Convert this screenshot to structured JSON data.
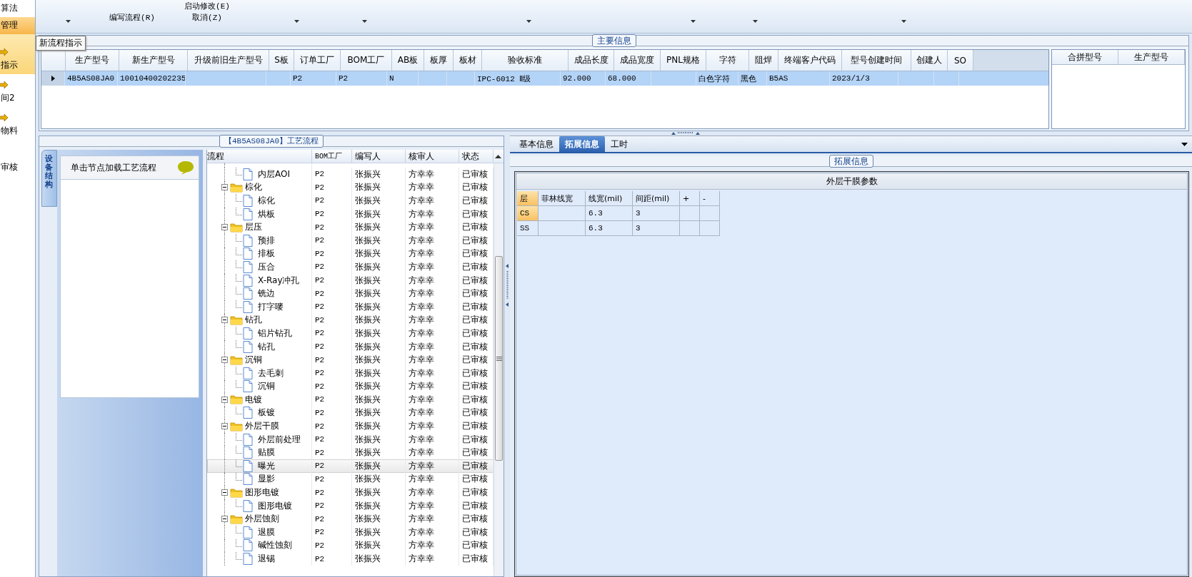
{
  "sidebar": {
    "items": [
      {
        "label": "算法",
        "selected": false,
        "icon": false
      },
      {
        "label": "管理",
        "selected": true,
        "icon": false
      },
      {
        "label": "指示",
        "selected": false,
        "icon": true
      },
      {
        "label": "间2",
        "selected": false,
        "icon": true
      },
      {
        "label": "物料",
        "selected": false,
        "icon": true
      },
      {
        "label": "审核",
        "selected": false,
        "icon": false
      }
    ],
    "tooltip": "新流程指示"
  },
  "toolbar": [
    {
      "menu": true
    },
    {
      "lines": [
        "编写流程(R)"
      ],
      "menu": false
    },
    {
      "lines": [
        "启动修改(E)",
        "取消(Z)"
      ],
      "menu": false
    },
    {
      "menu": true
    },
    {
      "menu": true
    },
    {
      "menu": true
    },
    {
      "menu": true
    },
    {
      "menu": true
    },
    {
      "menu": true
    }
  ],
  "main_info": {
    "title": "主要信息",
    "columns": [
      "生产型号",
      "新生产型号",
      "升级前旧生产型号",
      "S板",
      "订单工厂",
      "BOM工厂",
      "AB板",
      "板厚",
      "板材",
      "验收标准",
      "成品长度",
      "成品宽度",
      "PNL规格",
      "字符",
      "阻焊",
      "终端客户代码",
      "型号创建时间",
      "创建人",
      "SO"
    ],
    "rows": [
      {
        "selected": true,
        "cells": [
          "4B5AS08JA0",
          "10010400202235",
          "",
          "",
          "P2",
          "P2",
          "N",
          "",
          "",
          "IPC-6012 Ⅱ级",
          "92.000",
          "68.000",
          "",
          "白色字符",
          "黑色",
          "B5AS",
          "2023/1/3",
          "",
          ""
        ]
      }
    ],
    "merge_columns": [
      "合拼型号",
      "生产型号"
    ]
  },
  "process": {
    "title": "【4B5AS08JA0】工艺流程",
    "side_tab": "设备结构",
    "node_hint": "单击节点加载工艺流程",
    "columns": [
      "流程",
      "BOM工厂",
      "编写人",
      "核审人",
      "状态"
    ],
    "groups": [
      {
        "expanded": true,
        "children": [
          {
            "name": "内层AOI",
            "bom": "P2",
            "writer": "张振兴",
            "reviewer": "方幸幸",
            "status": "已审核",
            "selected": false
          }
        ]
      },
      {
        "name": "棕化",
        "bom": "P2",
        "writer": "张振兴",
        "reviewer": "方幸幸",
        "status": "已审核",
        "expanded": true,
        "children": [
          {
            "name": "棕化",
            "bom": "P2",
            "writer": "张振兴",
            "reviewer": "方幸幸",
            "status": "已审核",
            "selected": false
          },
          {
            "name": "烘板",
            "bom": "P2",
            "writer": "张振兴",
            "reviewer": "方幸幸",
            "status": "已审核",
            "selected": false
          }
        ]
      },
      {
        "name": "层压",
        "bom": "P2",
        "writer": "张振兴",
        "reviewer": "方幸幸",
        "status": "已审核",
        "expanded": true,
        "children": [
          {
            "name": "预排",
            "bom": "P2",
            "writer": "张振兴",
            "reviewer": "方幸幸",
            "status": "已审核",
            "selected": false
          },
          {
            "name": "排板",
            "bom": "P2",
            "writer": "张振兴",
            "reviewer": "方幸幸",
            "status": "已审核",
            "selected": false
          },
          {
            "name": "压合",
            "bom": "P2",
            "writer": "张振兴",
            "reviewer": "方幸幸",
            "status": "已审核",
            "selected": false
          },
          {
            "name": "X-Ray冲孔",
            "bom": "P2",
            "writer": "张振兴",
            "reviewer": "方幸幸",
            "status": "已审核",
            "selected": false
          },
          {
            "name": "铣边",
            "bom": "P2",
            "writer": "张振兴",
            "reviewer": "方幸幸",
            "status": "已审核",
            "selected": false
          },
          {
            "name": "打字嘜",
            "bom": "P2",
            "writer": "张振兴",
            "reviewer": "方幸幸",
            "status": "已审核",
            "selected": false
          }
        ]
      },
      {
        "name": "钻孔",
        "bom": "P2",
        "writer": "张振兴",
        "reviewer": "方幸幸",
        "status": "已审核",
        "expanded": true,
        "children": [
          {
            "name": "铝片钻孔",
            "bom": "P2",
            "writer": "张振兴",
            "reviewer": "方幸幸",
            "status": "已审核",
            "selected": false
          },
          {
            "name": "钻孔",
            "bom": "P2",
            "writer": "张振兴",
            "reviewer": "方幸幸",
            "status": "已审核",
            "selected": false
          }
        ]
      },
      {
        "name": "沉铜",
        "bom": "P2",
        "writer": "张振兴",
        "reviewer": "方幸幸",
        "status": "已审核",
        "expanded": true,
        "children": [
          {
            "name": "去毛刺",
            "bom": "P2",
            "writer": "张振兴",
            "reviewer": "方幸幸",
            "status": "已审核",
            "selected": false
          },
          {
            "name": "沉铜",
            "bom": "P2",
            "writer": "张振兴",
            "reviewer": "方幸幸",
            "status": "已审核",
            "selected": false
          }
        ]
      },
      {
        "name": "电镀",
        "bom": "P2",
        "writer": "张振兴",
        "reviewer": "方幸幸",
        "status": "已审核",
        "expanded": true,
        "children": [
          {
            "name": "板镀",
            "bom": "P2",
            "writer": "张振兴",
            "reviewer": "方幸幸",
            "status": "已审核",
            "selected": false
          }
        ]
      },
      {
        "name": "外层干膜",
        "bom": "P2",
        "writer": "张振兴",
        "reviewer": "方幸幸",
        "status": "已审核",
        "expanded": true,
        "children": [
          {
            "name": "外层前处理",
            "bom": "P2",
            "writer": "张振兴",
            "reviewer": "方幸幸",
            "status": "已审核",
            "selected": false
          },
          {
            "name": "贴膜",
            "bom": "P2",
            "writer": "张振兴",
            "reviewer": "方幸幸",
            "status": "已审核",
            "selected": false
          },
          {
            "name": "曝光",
            "bom": "P2",
            "writer": "张振兴",
            "reviewer": "方幸幸",
            "status": "已审核",
            "selected": true
          },
          {
            "name": "显影",
            "bom": "P2",
            "writer": "张振兴",
            "reviewer": "方幸幸",
            "status": "已审核",
            "selected": false
          }
        ]
      },
      {
        "name": "图形电镀",
        "bom": "P2",
        "writer": "张振兴",
        "reviewer": "方幸幸",
        "status": "已审核",
        "expanded": true,
        "children": [
          {
            "name": "图形电镀",
            "bom": "P2",
            "writer": "张振兴",
            "reviewer": "方幸幸",
            "status": "已审核",
            "selected": false
          }
        ]
      },
      {
        "name": "外层蚀刻",
        "bom": "P2",
        "writer": "张振兴",
        "reviewer": "方幸幸",
        "status": "已审核",
        "expanded": true,
        "children": [
          {
            "name": "退膜",
            "bom": "P2",
            "writer": "张振兴",
            "reviewer": "方幸幸",
            "status": "已审核",
            "selected": false
          },
          {
            "name": "碱性蚀刻",
            "bom": "P2",
            "writer": "张振兴",
            "reviewer": "方幸幸",
            "status": "已审核",
            "selected": false
          },
          {
            "name": "退锡",
            "bom": "P2",
            "writer": "张振兴",
            "reviewer": "方幸幸",
            "status": "已审核",
            "selected": false
          }
        ]
      }
    ]
  },
  "detail": {
    "tabs": [
      {
        "label": "基本信息",
        "selected": false
      },
      {
        "label": "拓展信息",
        "selected": true
      },
      {
        "label": "工时",
        "selected": false
      }
    ],
    "group_title": "拓展信息",
    "table_title": "外层干膜参数",
    "columns": [
      "层",
      "菲林线宽",
      "线宽(mil)",
      "间距(mil)",
      "+",
      "-"
    ],
    "rows": [
      {
        "selected": true,
        "cells": [
          "CS",
          "",
          "6.3",
          "3",
          "",
          ""
        ]
      },
      {
        "selected": false,
        "cells": [
          "SS",
          "",
          "6.3",
          "3",
          "",
          ""
        ]
      }
    ]
  }
}
